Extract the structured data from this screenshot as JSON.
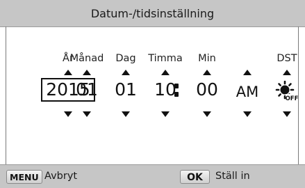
{
  "header": {
    "title": "Datum-/tidsinställning"
  },
  "fields": {
    "year": {
      "label": "År",
      "value": "2015"
    },
    "month": {
      "label": "Månad",
      "value": "01"
    },
    "day": {
      "label": "Dag",
      "value": "01"
    },
    "hour": {
      "label": "Timma",
      "value": "10"
    },
    "minute": {
      "label": "Min",
      "value": "00"
    },
    "ampm": {
      "label": "",
      "value": "AM"
    },
    "dst": {
      "label": "DST",
      "icon": "dst-off-icon",
      "icon_text": "OFF"
    }
  },
  "footer": {
    "menu_key": "MENU",
    "menu_label": "Avbryt",
    "ok_key": "OK",
    "ok_label": "Ställ in"
  }
}
